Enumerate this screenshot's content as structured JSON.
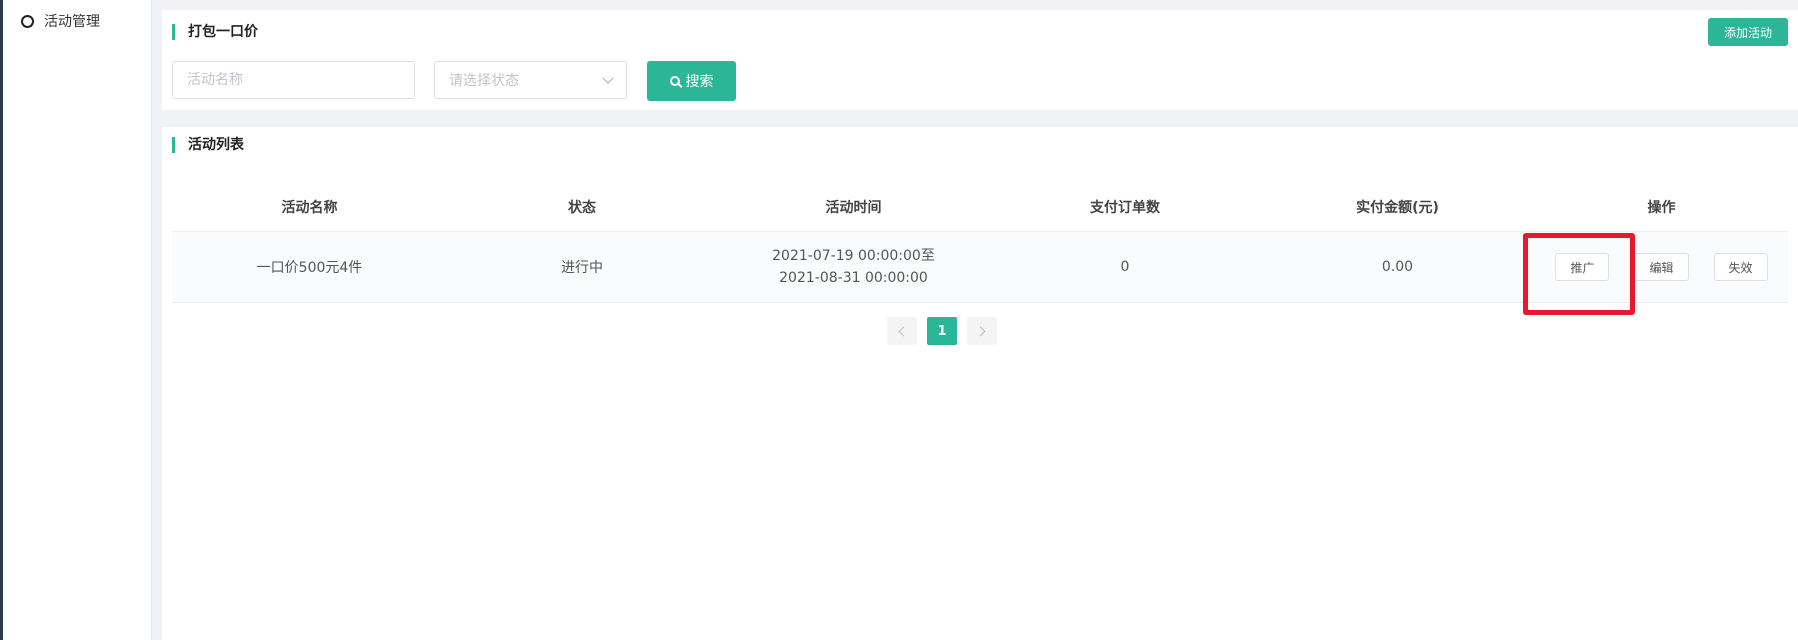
{
  "sidebar": {
    "items": [
      {
        "label": "活动管理"
      }
    ]
  },
  "filter_panel": {
    "title": "打包一口价",
    "add_button": "添加活动",
    "name_placeholder": "活动名称",
    "status_placeholder": "请选择状态",
    "search_button": "搜索"
  },
  "list_panel": {
    "title": "活动列表",
    "columns": [
      "活动名称",
      "状态",
      "活动时间",
      "支付订单数",
      "实付金额(元)",
      "操作"
    ],
    "rows": [
      {
        "name": "一口价500元4件",
        "status": "进行中",
        "time": "2021-07-19 00:00:00至2021-08-31 00:00:00",
        "orders": "0",
        "amount": "0.00",
        "actions": [
          "推广",
          "编辑",
          "失效"
        ]
      }
    ]
  },
  "pagination": {
    "current": "1"
  },
  "colors": {
    "accent": "#2bb797",
    "highlight": "#e8192c"
  }
}
